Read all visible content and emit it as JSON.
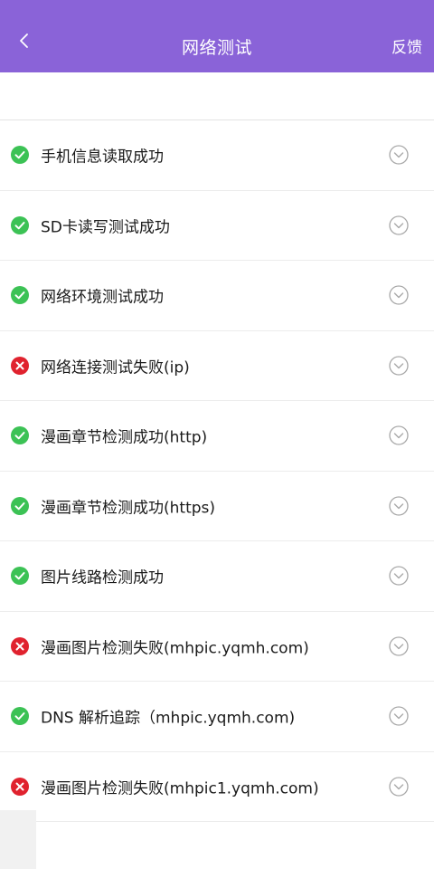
{
  "header": {
    "title": "网络测试",
    "feedback_label": "反馈",
    "back_icon": "chevron-left-icon",
    "bg_color": "#8a63d8"
  },
  "status_colors": {
    "success": "#3cc255",
    "fail": "#e0222e"
  },
  "tests": [
    {
      "label": "手机信息读取成功",
      "status": "success"
    },
    {
      "label": "SD卡读写测试成功",
      "status": "success"
    },
    {
      "label": "网络环境测试成功",
      "status": "success"
    },
    {
      "label": "网络连接测试失败(ip)",
      "status": "fail"
    },
    {
      "label": "漫画章节检测成功(http)",
      "status": "success"
    },
    {
      "label": "漫画章节检测成功(https)",
      "status": "success"
    },
    {
      "label": "图片线路检测成功",
      "status": "success"
    },
    {
      "label": "漫画图片检测失败(mhpic.yqmh.com)",
      "status": "fail"
    },
    {
      "label": "DNS 解析追踪（mhpic.yqmh.com)",
      "status": "success"
    },
    {
      "label": "漫画图片检测失败(mhpic1.yqmh.com)",
      "status": "fail"
    }
  ]
}
